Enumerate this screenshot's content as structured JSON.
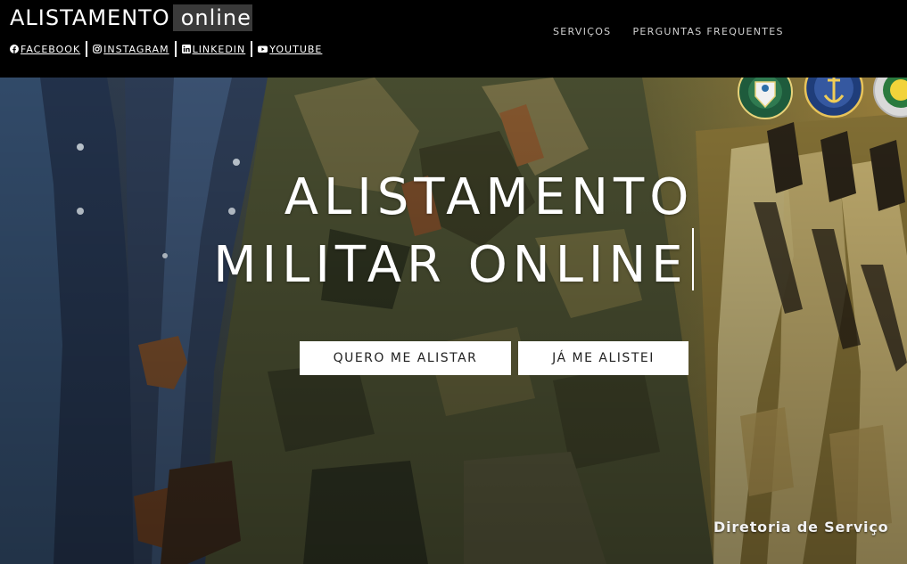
{
  "header": {
    "brand_main": "ALISTAMENTO",
    "brand_sub": "online",
    "social": [
      {
        "label": "FACEBOOK",
        "icon": "facebook-icon"
      },
      {
        "label": "INSTAGRAM",
        "icon": "instagram-icon"
      },
      {
        "label": "LINKEDIN",
        "icon": "linkedin-icon"
      },
      {
        "label": "YOUTUBE",
        "icon": "youtube-icon"
      }
    ],
    "nav": [
      {
        "label": "SERVIÇOS"
      },
      {
        "label": "PERGUNTAS FREQUENTES"
      }
    ]
  },
  "hero": {
    "title_line1": "ALISTAMENTO",
    "title_line2": "MILITAR ONLINE",
    "buttons": [
      {
        "label": "QUERO ME ALISTAR"
      },
      {
        "label": "JÁ ME ALISTEI"
      }
    ],
    "caption": "Diretoria de Serviço"
  },
  "colors": {
    "topbar": "#000000",
    "button_bg": "#ffffff",
    "button_text": "#222222",
    "hero_left": "#2b3a52",
    "hero_mid": "#4e5034",
    "hero_right": "#a5873e"
  }
}
